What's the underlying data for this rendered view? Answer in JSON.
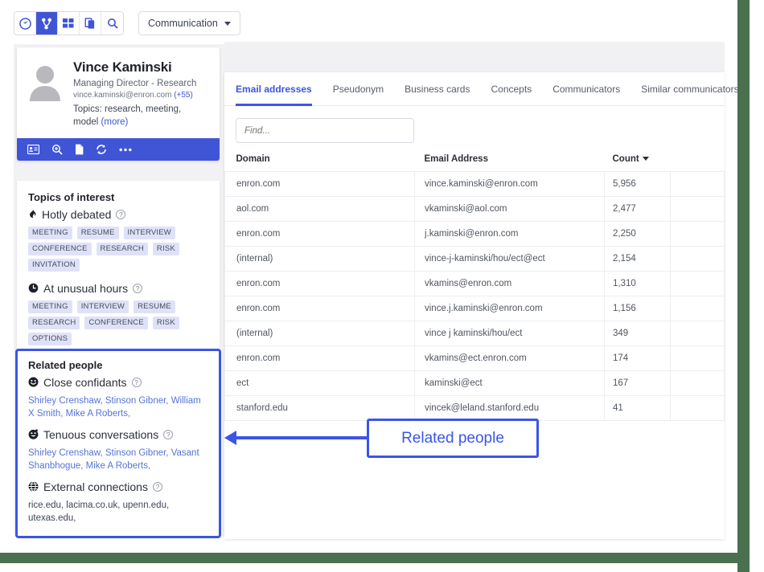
{
  "toolbar": {
    "icons": [
      {
        "name": "gauge-icon",
        "label": "Dashboard"
      },
      {
        "name": "network-branch-icon",
        "label": "Communication",
        "active": true
      },
      {
        "name": "grid-icon",
        "label": "Grid"
      },
      {
        "name": "documents-icon",
        "label": "Documents"
      },
      {
        "name": "search-icon",
        "label": "Search"
      }
    ],
    "dropdown_label": "Communication"
  },
  "profile": {
    "name": "Vince Kaminski",
    "role": "Managing Director - Research",
    "email": "vince.kaminski@enron.com",
    "email_more": "(+55)",
    "topics_prefix": "Topics: research, meeting, model",
    "more_label": "(more)",
    "actions": [
      {
        "name": "contact-card-icon"
      },
      {
        "name": "zoom-search-icon"
      },
      {
        "name": "document-icon"
      },
      {
        "name": "refresh-icon"
      },
      {
        "name": "more-options-icon"
      }
    ]
  },
  "topics": {
    "title": "Topics of interest",
    "sections": [
      {
        "icon": "fire-icon",
        "glyph": "◕",
        "label": "Hotly debated",
        "tags": [
          "MEETING",
          "RESUME",
          "INTERVIEW",
          "CONFERENCE",
          "RESEARCH",
          "RISK",
          "INVITATION"
        ]
      },
      {
        "icon": "clock-icon",
        "glyph": "🕓",
        "label": "At unusual hours",
        "tags": [
          "MEETING",
          "INTERVIEW",
          "RESUME",
          "RESEARCH",
          "CONFERENCE",
          "RISK",
          "OPTIONS"
        ]
      }
    ]
  },
  "related_people": {
    "title": "Related people",
    "sections": [
      {
        "icon": "smiley-icon",
        "glyph": "☻",
        "label": "Close confidants",
        "values": "Shirley Crenshaw, Stinson Gibner, William X Smith, Mike A Roberts,",
        "value_type": "people"
      },
      {
        "icon": "grin-icon",
        "glyph": "☻",
        "label": "Tenuous conversations",
        "values": "Shirley Crenshaw, Stinson Gibner, Vasant Shanbhogue, Mike A Roberts,",
        "value_type": "people"
      },
      {
        "icon": "globe-icon",
        "glyph": "⊕",
        "label": "External connections",
        "values": "rice.edu, lacima.co.uk, upenn.edu, utexas.edu,",
        "value_type": "domains"
      }
    ]
  },
  "main": {
    "tabs": [
      {
        "label": "Email addresses",
        "active": true
      },
      {
        "label": "Pseudonym",
        "active": false
      },
      {
        "label": "Business cards",
        "active": false
      },
      {
        "label": "Concepts",
        "active": false
      },
      {
        "label": "Communicators",
        "active": false
      },
      {
        "label": "Similar communicators",
        "active": false
      }
    ],
    "find_placeholder": "Find...",
    "find_value": "",
    "table": {
      "columns": [
        "Domain",
        "Email Address",
        "Count"
      ],
      "sorted_column": "Count",
      "rows": [
        {
          "domain": "enron.com",
          "email": "vince.kaminski@enron.com",
          "count": "5,956"
        },
        {
          "domain": "aol.com",
          "email": "vkaminski@aol.com",
          "count": "2,477"
        },
        {
          "domain": "enron.com",
          "email": "j.kaminski@enron.com",
          "count": "2,250"
        },
        {
          "domain": "(internal)",
          "email": "vince-j-kaminski/hou/ect@ect",
          "count": "2,154"
        },
        {
          "domain": "enron.com",
          "email": "vkamins@enron.com",
          "count": "1,310"
        },
        {
          "domain": "enron.com",
          "email": "vince.j.kaminski@enron.com",
          "count": "1,156"
        },
        {
          "domain": "(internal)",
          "email": "vince j kaminski/hou/ect",
          "count": "349"
        },
        {
          "domain": "enron.com",
          "email": "vkamins@ect.enron.com",
          "count": "174"
        },
        {
          "domain": "ect",
          "email": "kaminski@ect",
          "count": "167"
        },
        {
          "domain": "stanford.edu",
          "email": "vincek@leland.stanford.edu",
          "count": "41"
        }
      ]
    }
  },
  "annotation": {
    "label": "Related people",
    "color": "#3b55e8"
  },
  "colors": {
    "accent": "#4054d6",
    "annotation": "#3b55e8",
    "frame": "#4a7050",
    "tag_bg": "#dfe2f7",
    "link": "#5574d6"
  }
}
